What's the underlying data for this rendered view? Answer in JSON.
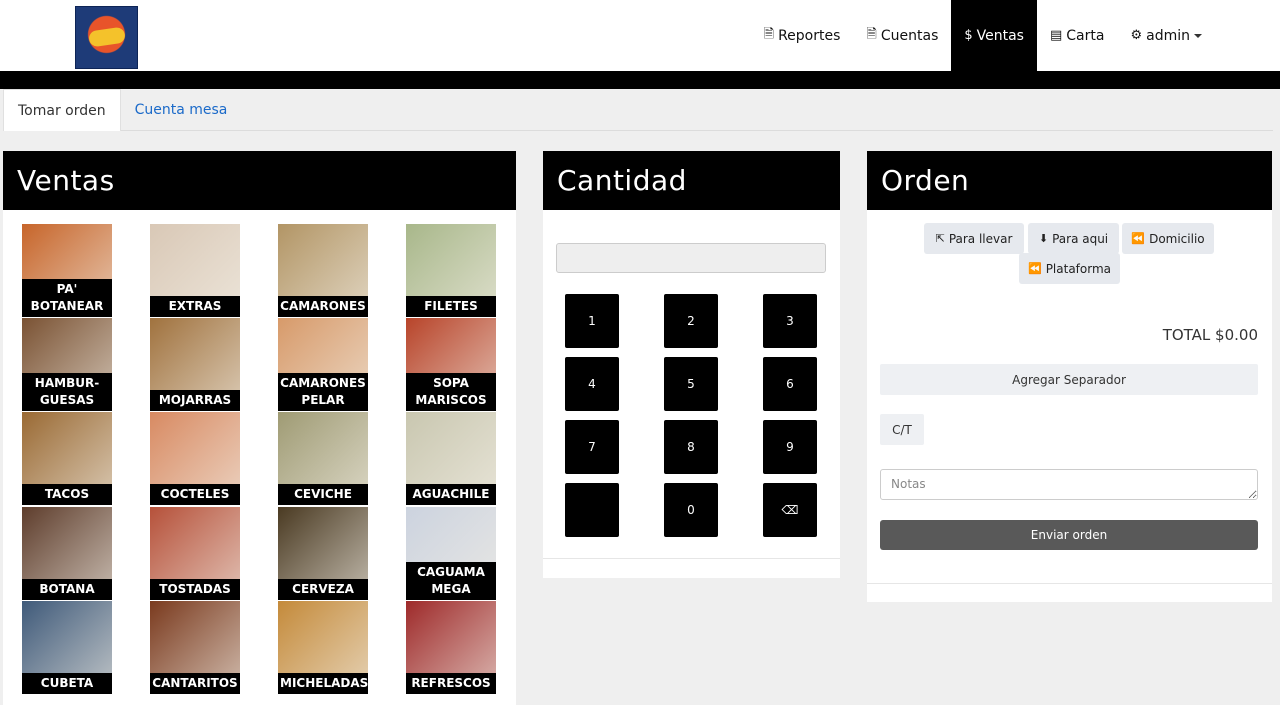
{
  "nav": {
    "items": [
      {
        "icon": "file-icon",
        "glyph": "🗎",
        "label": "Reportes",
        "active": false
      },
      {
        "icon": "file-icon",
        "glyph": "🗎",
        "label": "Cuentas",
        "active": false
      },
      {
        "icon": "dollar-icon",
        "glyph": "$",
        "label": "Ventas",
        "active": true
      },
      {
        "icon": "book-icon",
        "glyph": "▤",
        "label": "Carta",
        "active": false
      },
      {
        "icon": "gear-icon",
        "glyph": "⚙",
        "label": "admin",
        "active": false
      }
    ]
  },
  "tabs": [
    {
      "label": "Tomar orden",
      "active": true
    },
    {
      "label": "Cuenta mesa",
      "active": false
    }
  ],
  "ventas": {
    "title": "Ventas",
    "categories": [
      {
        "label": "PA' BOTANEAR",
        "color": "#c7652a"
      },
      {
        "label": "EXTRAS",
        "color": "#d9c8b6"
      },
      {
        "label": "CAMARONES",
        "color": "#b29565"
      },
      {
        "label": "FILETES",
        "color": "#a8b78a"
      },
      {
        "label": "HAMBUR-GUESAS",
        "color": "#7a5233"
      },
      {
        "label": "MOJARRAS",
        "color": "#a0723e"
      },
      {
        "label": "CAMARONES PELAR",
        "color": "#d79a6a"
      },
      {
        "label": "SOPA MARISCOS",
        "color": "#b8442a"
      },
      {
        "label": "TACOS",
        "color": "#9a6a34"
      },
      {
        "label": "COCTELES",
        "color": "#d88a62"
      },
      {
        "label": "CEVICHE",
        "color": "#9f9b74"
      },
      {
        "label": "AGUACHILE",
        "color": "#c9c7b0"
      },
      {
        "label": "BOTANA",
        "color": "#5e3d2c"
      },
      {
        "label": "TOSTADAS",
        "color": "#b6513a"
      },
      {
        "label": "CERVEZA",
        "color": "#4a3a22"
      },
      {
        "label": "CAGUAMA MEGA",
        "color": "#ccd3df"
      },
      {
        "label": "CUBETA",
        "color": "#3f5a7a"
      },
      {
        "label": "CANTARITOS",
        "color": "#7a3a1e"
      },
      {
        "label": "MICHELADAS",
        "color": "#c48a3a"
      },
      {
        "label": "REFRESCOS",
        "color": "#9e2a2a"
      }
    ]
  },
  "cantidad": {
    "title": "Cantidad",
    "value": "",
    "keys": [
      "1",
      "2",
      "3",
      "4",
      "5",
      "6",
      "7",
      "8",
      "9",
      "",
      "0",
      "⌫"
    ]
  },
  "orden": {
    "title": "Orden",
    "buttons": [
      {
        "label": "Para llevar",
        "glyph": "⇱"
      },
      {
        "label": "Para aqui",
        "glyph": "⬇"
      },
      {
        "label": "Domicilio",
        "glyph": "⏪"
      },
      {
        "label": "Plataforma",
        "glyph": "⏪"
      }
    ],
    "total": "TOTAL $0.00",
    "separator_label": "Agregar Separador",
    "ct_label": "C/T",
    "notes_placeholder": "Notas",
    "send_label": "Enviar orden"
  }
}
